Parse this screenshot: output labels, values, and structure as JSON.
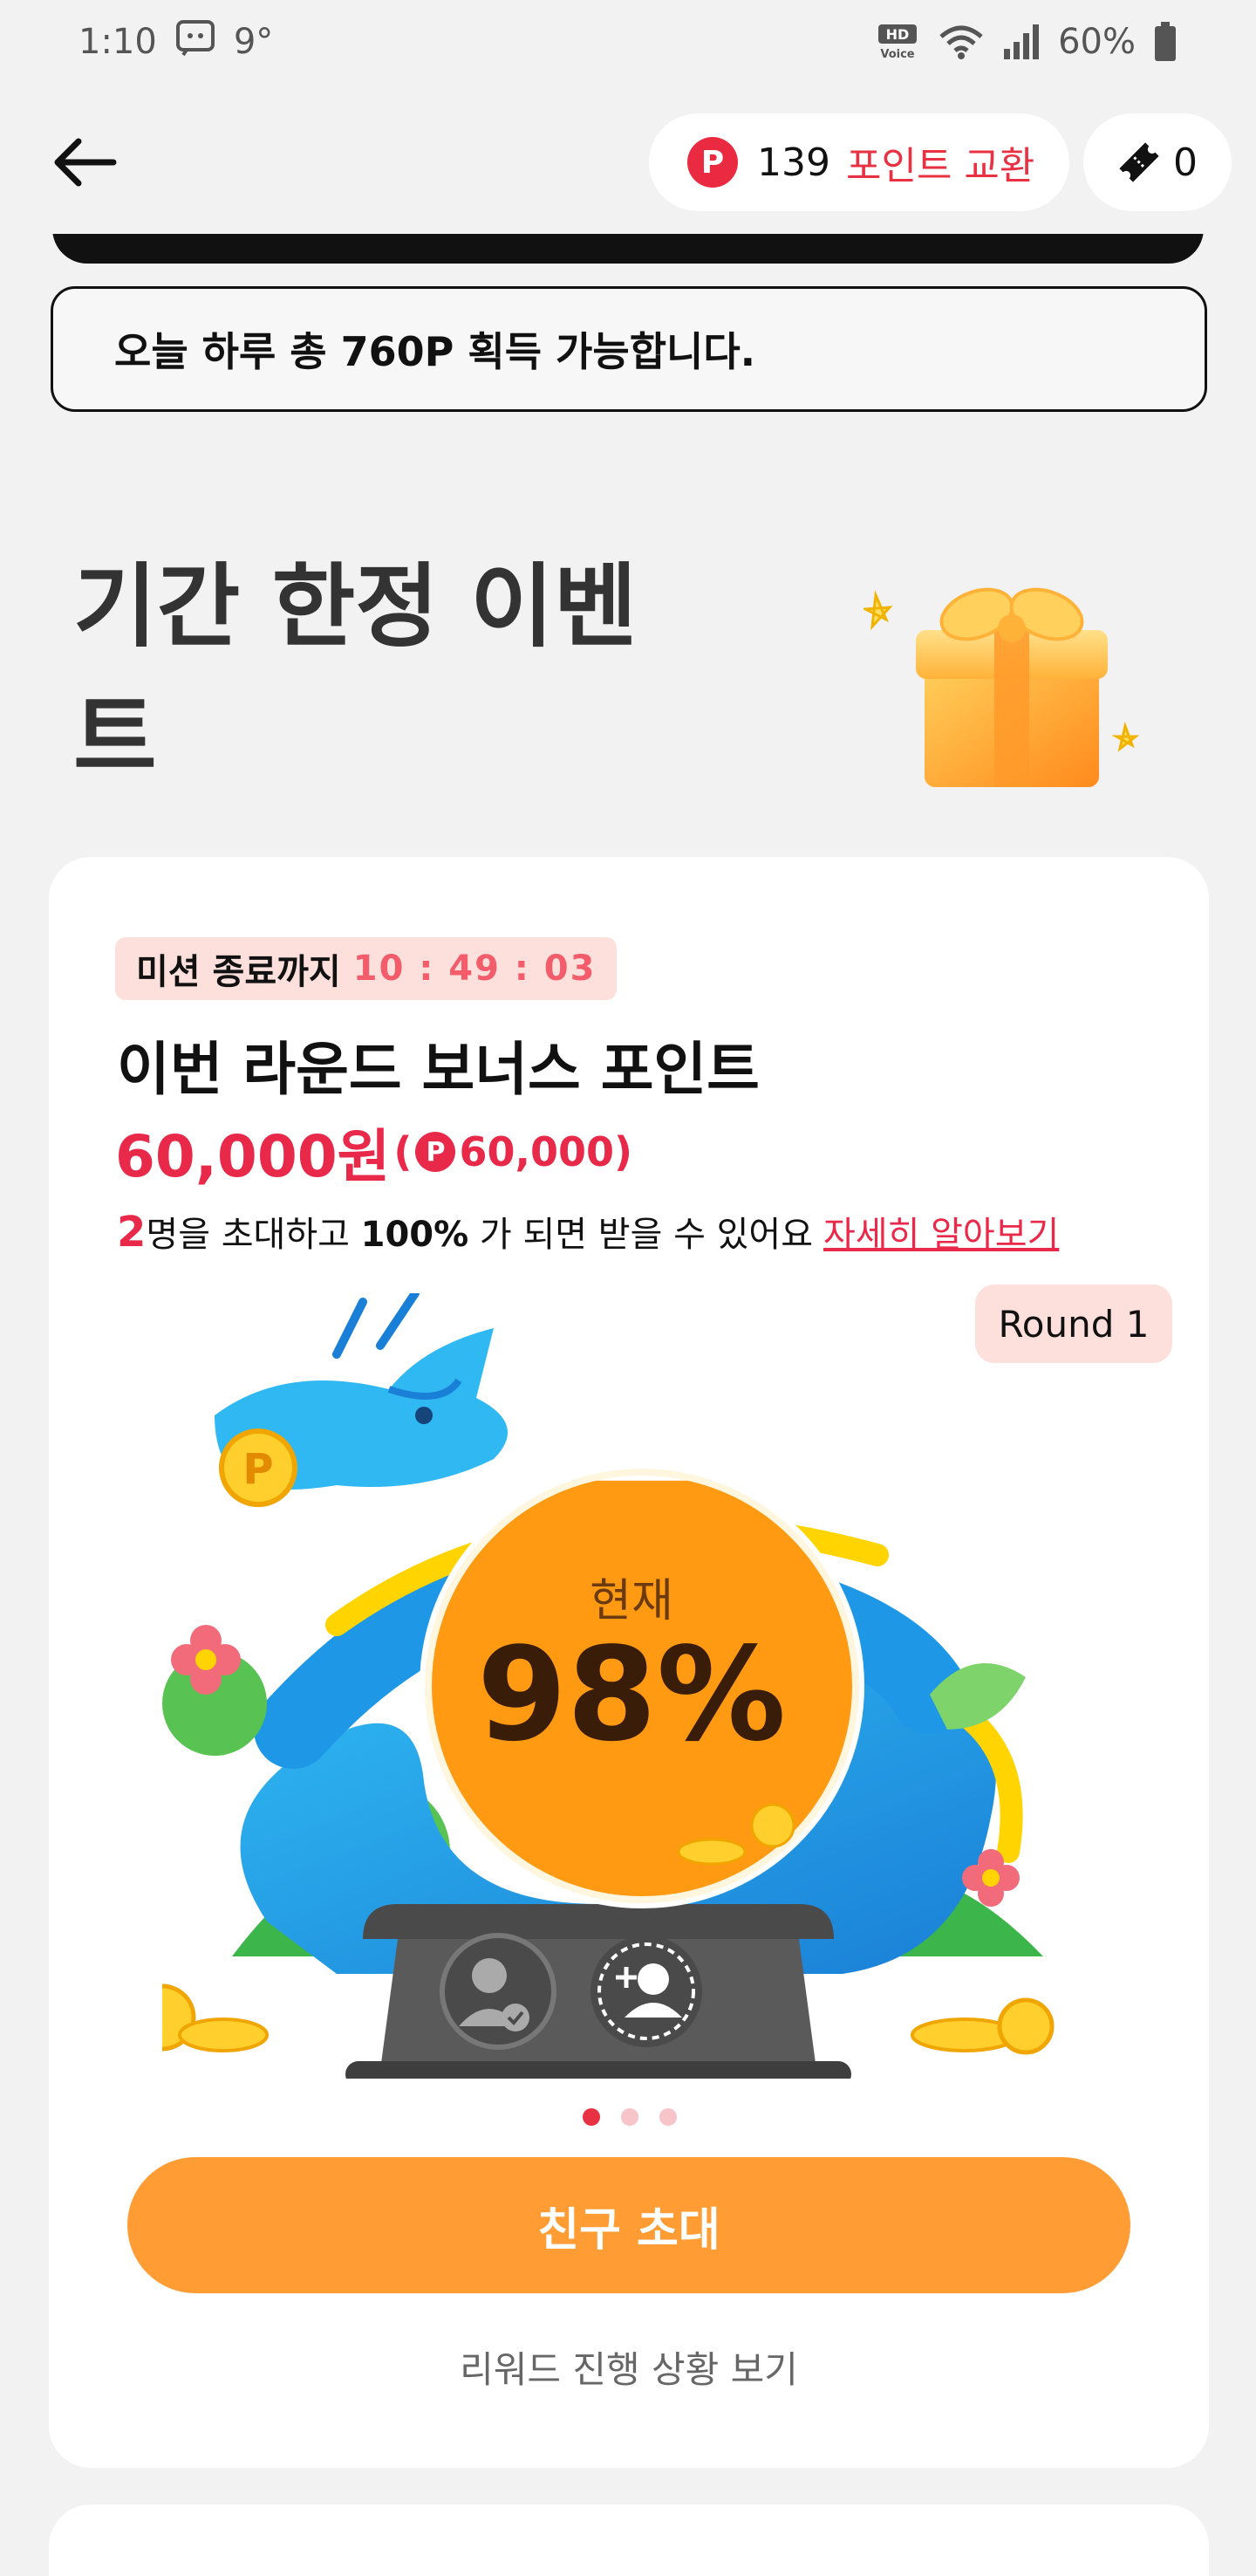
{
  "status": {
    "time": "1:10",
    "temperature": "9°",
    "network": "HD Voice",
    "battery": "60%"
  },
  "topbar": {
    "points": "139",
    "points_link": "포인트 교환",
    "p_symbol": "P",
    "tickets": "0"
  },
  "notice": "오늘 하루 총 760P 획득 가능합니다.",
  "section": {
    "title": "기간 한정 이벤트"
  },
  "mission": {
    "timer_label": "미션 종료까지",
    "timer_value": "10 : 49 : 03",
    "title": "이번 라운드 보너스 포인트",
    "prize_amount": "60,000원",
    "prize_open": "(",
    "prize_p": "P",
    "prize_points": "60,000",
    "prize_close": ")",
    "invite_count": "2",
    "invite_text_1": "명을 초대하고 ",
    "invite_pct": "100%",
    "invite_text_2": " 가 되면 받을 수 있어요",
    "learn_more": "자세히 알아보기",
    "round": "Round 1",
    "progress_label": "현재",
    "progress_value": "98%",
    "progress_fraction": 0.98,
    "carousel_pages": 3,
    "carousel_active": 0,
    "invite_button": "친구 초대",
    "reward_link": "리워드 진행 상황 보기"
  },
  "colors": {
    "accent_red": "#e83142",
    "button_orange": "#ff9c33",
    "badge_pink": "#fde0dc",
    "background": "#f2f2f2"
  }
}
